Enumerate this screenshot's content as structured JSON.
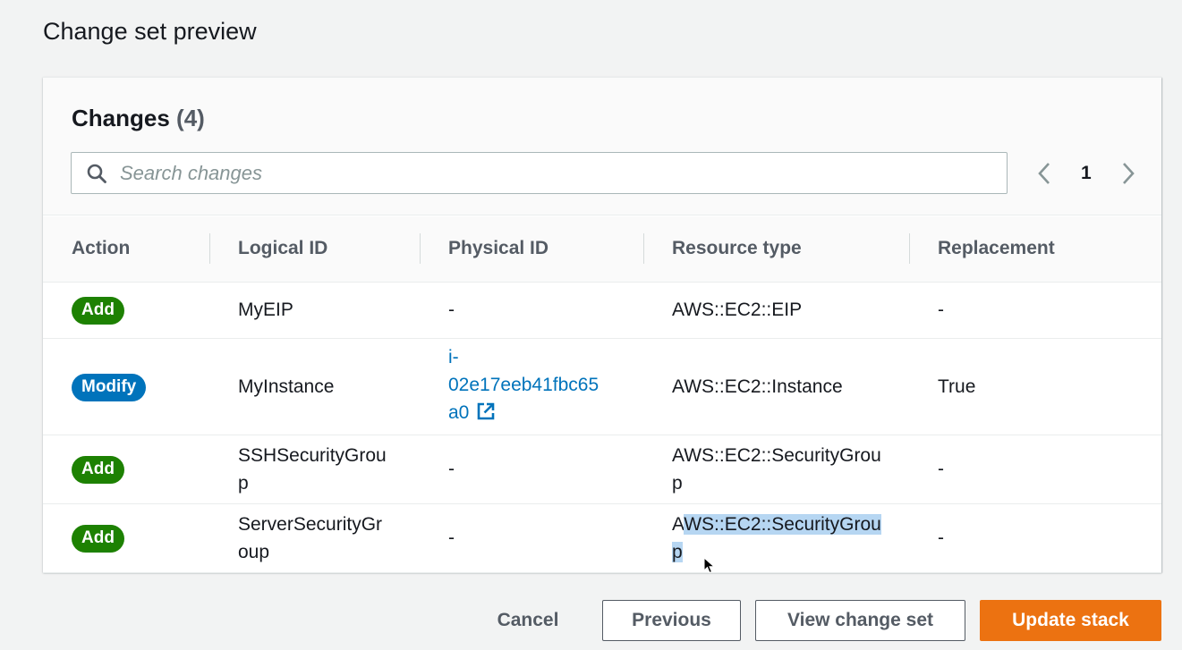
{
  "page": {
    "heading": "Change set preview"
  },
  "changes": {
    "title": "Changes",
    "count": "(4)",
    "search_placeholder": "Search changes",
    "page_number": "1",
    "columns": [
      "Action",
      "Logical ID",
      "Physical ID",
      "Resource type",
      "Replacement"
    ],
    "rows": [
      {
        "action": "Add",
        "action_kind": "add",
        "logical_id_lines": [
          "MyEIP"
        ],
        "physical_id_lines": [
          "-"
        ],
        "resource_type_lines": [
          "AWS::EC2::EIP"
        ],
        "replacement": "-"
      },
      {
        "action": "Modify",
        "action_kind": "modify",
        "logical_id_lines": [
          "MyInstance"
        ],
        "physical_id_lines": [
          "i-",
          "02e17eeb41fbc65",
          "a0"
        ],
        "physical_id_is_link": true,
        "resource_type_lines": [
          "AWS::EC2::Instance"
        ],
        "replacement": "True"
      },
      {
        "action": "Add",
        "action_kind": "add",
        "logical_id_lines": [
          "SSHSecurityGrou",
          "p"
        ],
        "physical_id_lines": [
          "-"
        ],
        "resource_type_lines": [
          "AWS::EC2::SecurityGrou",
          "p"
        ],
        "replacement": "-"
      },
      {
        "action": "Add",
        "action_kind": "add",
        "logical_id_lines": [
          "ServerSecurityGr",
          "oup"
        ],
        "physical_id_lines": [
          "-"
        ],
        "resource_type_lines": [
          "A",
          "WS::EC2::SecurityGrou",
          "p"
        ],
        "replacement": "-"
      }
    ]
  },
  "footer": {
    "cancel_label": "Cancel",
    "previous_label": "Previous",
    "view_change_set_label": "View change set",
    "update_stack_label": "Update stack"
  },
  "colors": {
    "add_badge": "#1d8102",
    "modify_badge": "#0073bb",
    "primary_button": "#ec7211",
    "link": "#0073bb",
    "text_selection": "#b6d6f2"
  },
  "icons": {
    "search": "search-icon",
    "prev_page": "chevron-left-icon",
    "next_page": "chevron-right-icon",
    "external_link": "external-link-icon",
    "cursor": "mouse-pointer-icon"
  }
}
